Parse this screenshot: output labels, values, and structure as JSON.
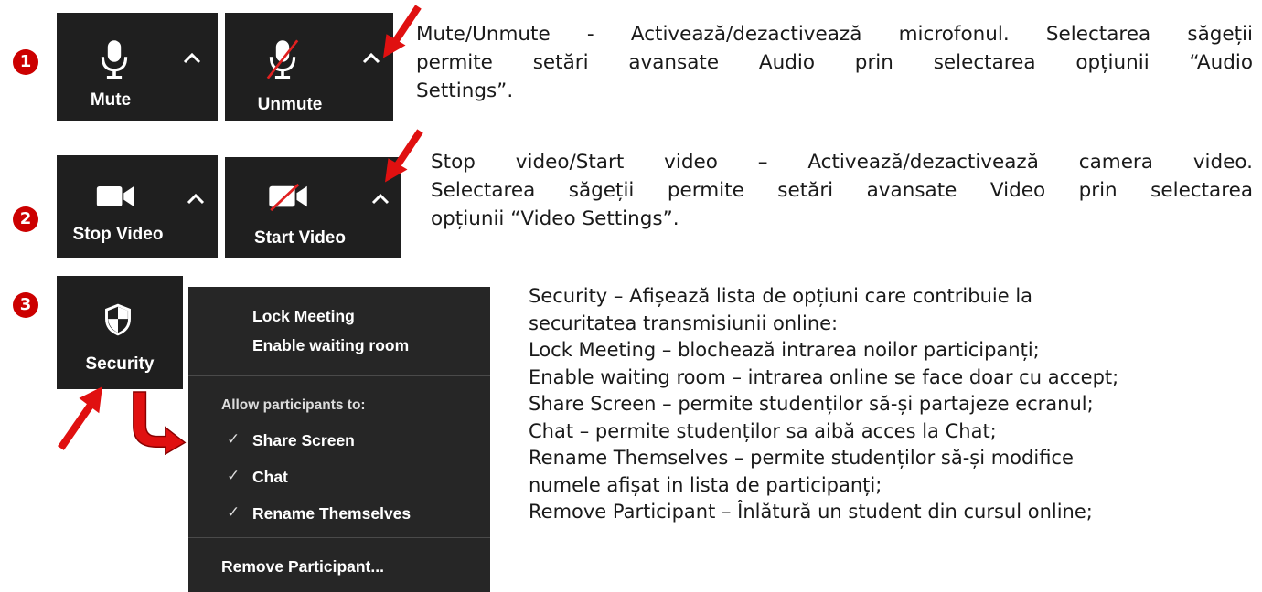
{
  "steps": {
    "one": "1",
    "two": "2",
    "three": "3"
  },
  "buttons": {
    "mute": "Mute",
    "unmute": "Unmute",
    "stop_video": "Stop Video",
    "start_video": "Start Video",
    "security": "Security"
  },
  "audio_description": {
    "line1": "Mute/Unmute - Activează/dezactivează microfonul. Selectarea săgeții",
    "line2": "permite setări avansate Audio prin selectarea opțiunii “Audio",
    "line3": "Settings”."
  },
  "video_description": {
    "line1": "Stop video/Start video – Activează/dezactivează camera video.",
    "line2": "Selectarea săgeții permite setări avansate Video prin selectarea",
    "line3": "opțiunii “Video Settings”."
  },
  "security_menu": {
    "lock_meeting": "Lock Meeting",
    "enable_waiting_room": "Enable waiting room",
    "allow_header": "Allow participants to:",
    "share_screen": "Share Screen",
    "chat": "Chat",
    "rename_themselves": "Rename Themselves",
    "remove_participant": "Remove Participant...",
    "check_mark": "✓"
  },
  "security_description": {
    "line1": "Security – Afișează lista de opțiuni care contribuie la",
    "line2": "securitatea transmisiunii online:",
    "line3": "Lock Meeting – blochează intrarea noilor participanți;",
    "line4": "Enable waiting room – intrarea online se face doar cu accept;",
    "line5": "Share Screen – permite studenților să-și partajeze ecranul;",
    "line6": "Chat – permite studenților sa aibă acces la Chat;",
    "line7": "Rename Themselves – permite studenților să-și modifice",
    "line8": "numele afișat in lista de participanți;",
    "line9": "Remove Participant – Înlătură un student din cursul online;"
  },
  "colors": {
    "accent_red": "#cc0000",
    "tile_background": "#1f1f1f",
    "menu_background": "#262626"
  }
}
